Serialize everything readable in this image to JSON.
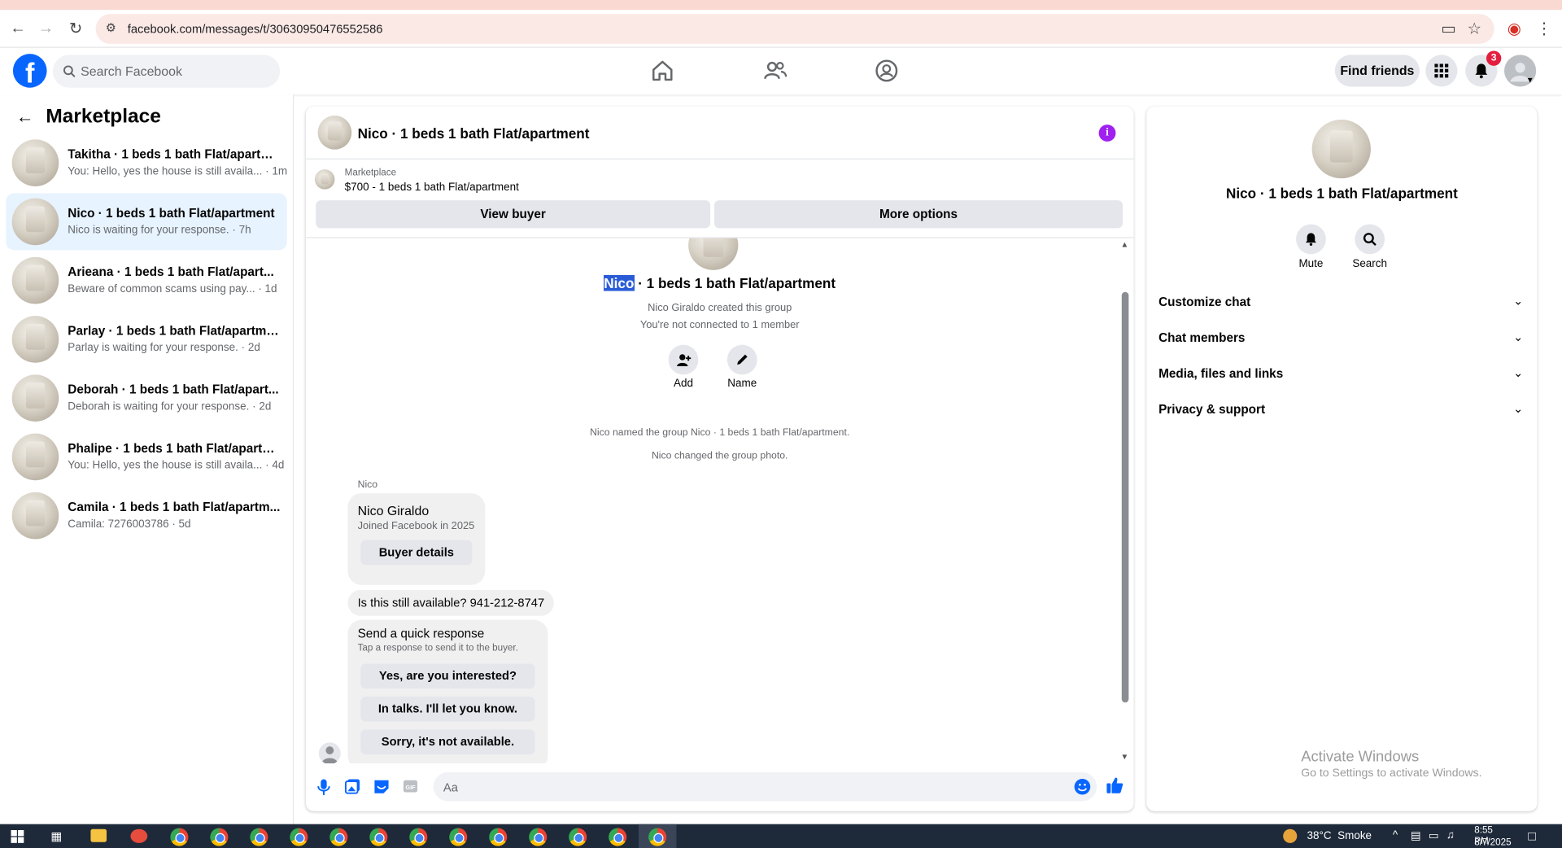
{
  "browser": {
    "url": "facebook.com/messages/t/30630950476552586"
  },
  "topbar": {
    "search_placeholder": "Search Facebook",
    "find_friends": "Find friends",
    "notification_count": "3"
  },
  "sidebar": {
    "title": "Marketplace",
    "conversations": [
      {
        "title": "Takitha · 1 beds 1 bath Flat/apartm...",
        "preview": "You: Hello, yes the house is still availa... · 1m"
      },
      {
        "title": "Nico · 1 beds 1 bath Flat/apartment",
        "preview": "Nico is waiting for your response. · 7h"
      },
      {
        "title": "Arieana · 1 beds 1 bath Flat/apart...",
        "preview": "Beware of common scams using pay... · 1d"
      },
      {
        "title": "Parlay · 1 beds 1 bath Flat/apartment",
        "preview": "Parlay is waiting for your response. · 2d"
      },
      {
        "title": "Deborah · 1 beds 1 bath Flat/apart...",
        "preview": "Deborah is waiting for your response. · 2d"
      },
      {
        "title": "Phalipe · 1 beds 1 bath Flat/apartm...",
        "preview": "You: Hello, yes the house is still availa... · 4d"
      },
      {
        "title": "Camila · 1 beds 1 bath Flat/apartm...",
        "preview": "Camila: 7276003786 · 5d"
      }
    ]
  },
  "chat": {
    "header_title": "Nico · 1 beds 1 bath Flat/apartment",
    "listing_source": "Marketplace",
    "listing_desc": "$700 - 1 beds 1 bath Flat/apartment",
    "view_buyer": "View buyer",
    "more_options": "More options",
    "group_name_highlight": "Nico",
    "group_name_rest": " · 1 beds 1 bath Flat/apartment",
    "created": "Nico Giraldo created this group",
    "not_connected": "You're not connected to 1 member",
    "add_label": "Add",
    "name_label": "Name",
    "event_named": "Nico named the group Nico · 1 beds 1 bath Flat/apartment.",
    "event_photo": "Nico changed the group photo.",
    "sender": "Nico",
    "card_name": "Nico Giraldo",
    "card_joined": "Joined Facebook in 2025",
    "buyer_details": "Buyer details",
    "message": "Is this still available? 941-212-8747",
    "quick_title": "Send a quick response",
    "quick_sub": "Tap a response to send it to the buyer.",
    "quick_responses": [
      "Yes, are you interested?",
      "In talks. I'll let you know.",
      "Sorry, it's not available."
    ],
    "composer_placeholder": "Aa"
  },
  "details": {
    "title": "Nico · 1 beds 1 bath Flat/apartment",
    "mute": "Mute",
    "search": "Search",
    "sections": [
      "Customize chat",
      "Chat members",
      "Media, files and links",
      "Privacy & support"
    ]
  },
  "watermark": {
    "line1": "Activate Windows",
    "line2": "Go to Settings to activate Windows."
  },
  "taskbar": {
    "weather": "38°C  Smoke",
    "time": "8:55 PM",
    "date": "8/7/2025"
  },
  "colors": {
    "fb_blue": "#0866ff",
    "active_conv": "#e7f3ff",
    "accent_purple": "#a020f0",
    "badge_red": "#e41e3f"
  }
}
